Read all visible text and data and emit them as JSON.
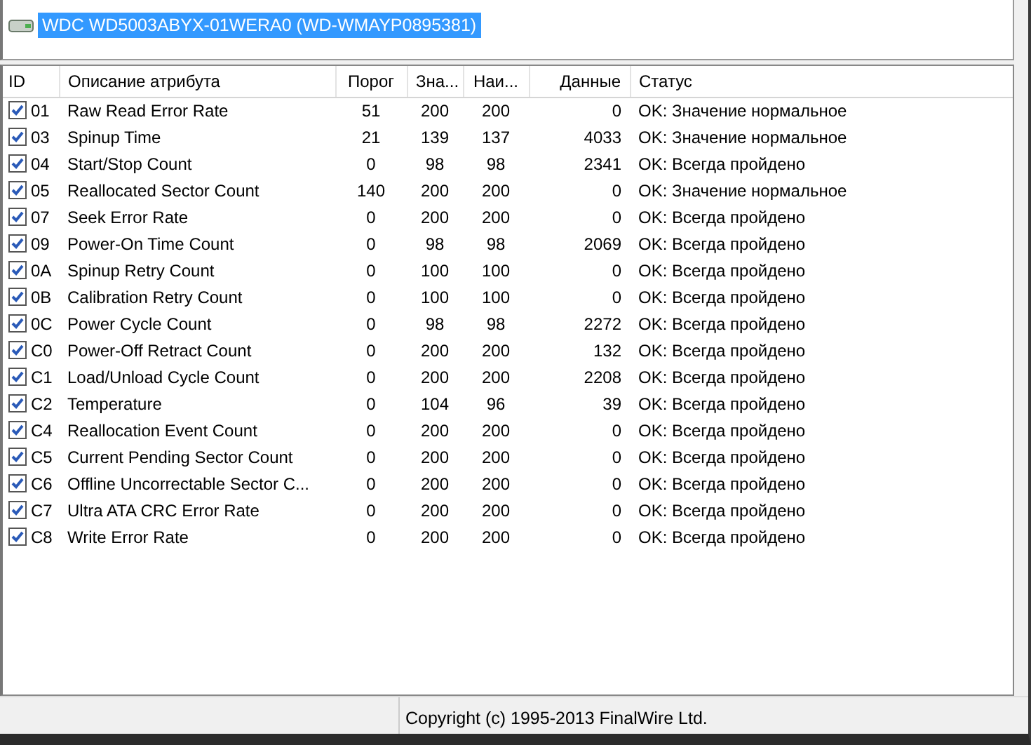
{
  "devices": [
    {
      "label": "WDC WD5003ABYX-01WERA0 (WD-WMAYP0895381)",
      "selected": true
    }
  ],
  "table": {
    "columns": [
      "ID",
      "Описание атрибута",
      "Порог",
      "Зна...",
      "Наи...",
      "Данные",
      "Статус"
    ],
    "rows": [
      {
        "checked": true,
        "cells": [
          "01",
          "Raw Read Error Rate",
          "51",
          "200",
          "200",
          "0",
          "OK: Значение нормальное"
        ]
      },
      {
        "checked": true,
        "cells": [
          "03",
          "Spinup Time",
          "21",
          "139",
          "137",
          "4033",
          "OK: Значение нормальное"
        ]
      },
      {
        "checked": true,
        "cells": [
          "04",
          "Start/Stop Count",
          "0",
          "98",
          "98",
          "2341",
          "OK: Всегда пройдено"
        ]
      },
      {
        "checked": true,
        "cells": [
          "05",
          "Reallocated Sector Count",
          "140",
          "200",
          "200",
          "0",
          "OK: Значение нормальное"
        ]
      },
      {
        "checked": true,
        "cells": [
          "07",
          "Seek Error Rate",
          "0",
          "200",
          "200",
          "0",
          "OK: Всегда пройдено"
        ]
      },
      {
        "checked": true,
        "cells": [
          "09",
          "Power-On Time Count",
          "0",
          "98",
          "98",
          "2069",
          "OK: Всегда пройдено"
        ]
      },
      {
        "checked": true,
        "cells": [
          "0A",
          "Spinup Retry Count",
          "0",
          "100",
          "100",
          "0",
          "OK: Всегда пройдено"
        ]
      },
      {
        "checked": true,
        "cells": [
          "0B",
          "Calibration Retry Count",
          "0",
          "100",
          "100",
          "0",
          "OK: Всегда пройдено"
        ]
      },
      {
        "checked": true,
        "cells": [
          "0C",
          "Power Cycle Count",
          "0",
          "98",
          "98",
          "2272",
          "OK: Всегда пройдено"
        ]
      },
      {
        "checked": true,
        "cells": [
          "C0",
          "Power-Off Retract Count",
          "0",
          "200",
          "200",
          "132",
          "OK: Всегда пройдено"
        ]
      },
      {
        "checked": true,
        "cells": [
          "C1",
          "Load/Unload Cycle Count",
          "0",
          "200",
          "200",
          "2208",
          "OK: Всегда пройдено"
        ]
      },
      {
        "checked": true,
        "cells": [
          "C2",
          "Temperature",
          "0",
          "104",
          "96",
          "39",
          "OK: Всегда пройдено"
        ]
      },
      {
        "checked": true,
        "cells": [
          "C4",
          "Reallocation Event Count",
          "0",
          "200",
          "200",
          "0",
          "OK: Всегда пройдено"
        ]
      },
      {
        "checked": true,
        "cells": [
          "C5",
          "Current Pending Sector Count",
          "0",
          "200",
          "200",
          "0",
          "OK: Всегда пройдено"
        ]
      },
      {
        "checked": true,
        "cells": [
          "C6",
          "Offline Uncorrectable Sector C...",
          "0",
          "200",
          "200",
          "0",
          "OK: Всегда пройдено"
        ]
      },
      {
        "checked": true,
        "cells": [
          "C7",
          "Ultra ATA CRC Error Rate",
          "0",
          "200",
          "200",
          "0",
          "OK: Всегда пройдено"
        ]
      },
      {
        "checked": true,
        "cells": [
          "C8",
          "Write Error Rate",
          "0",
          "200",
          "200",
          "0",
          "OK: Всегда пройдено"
        ]
      }
    ]
  },
  "status_bar": {
    "text": "Copyright (c) 1995-2013 FinalWire Ltd."
  }
}
